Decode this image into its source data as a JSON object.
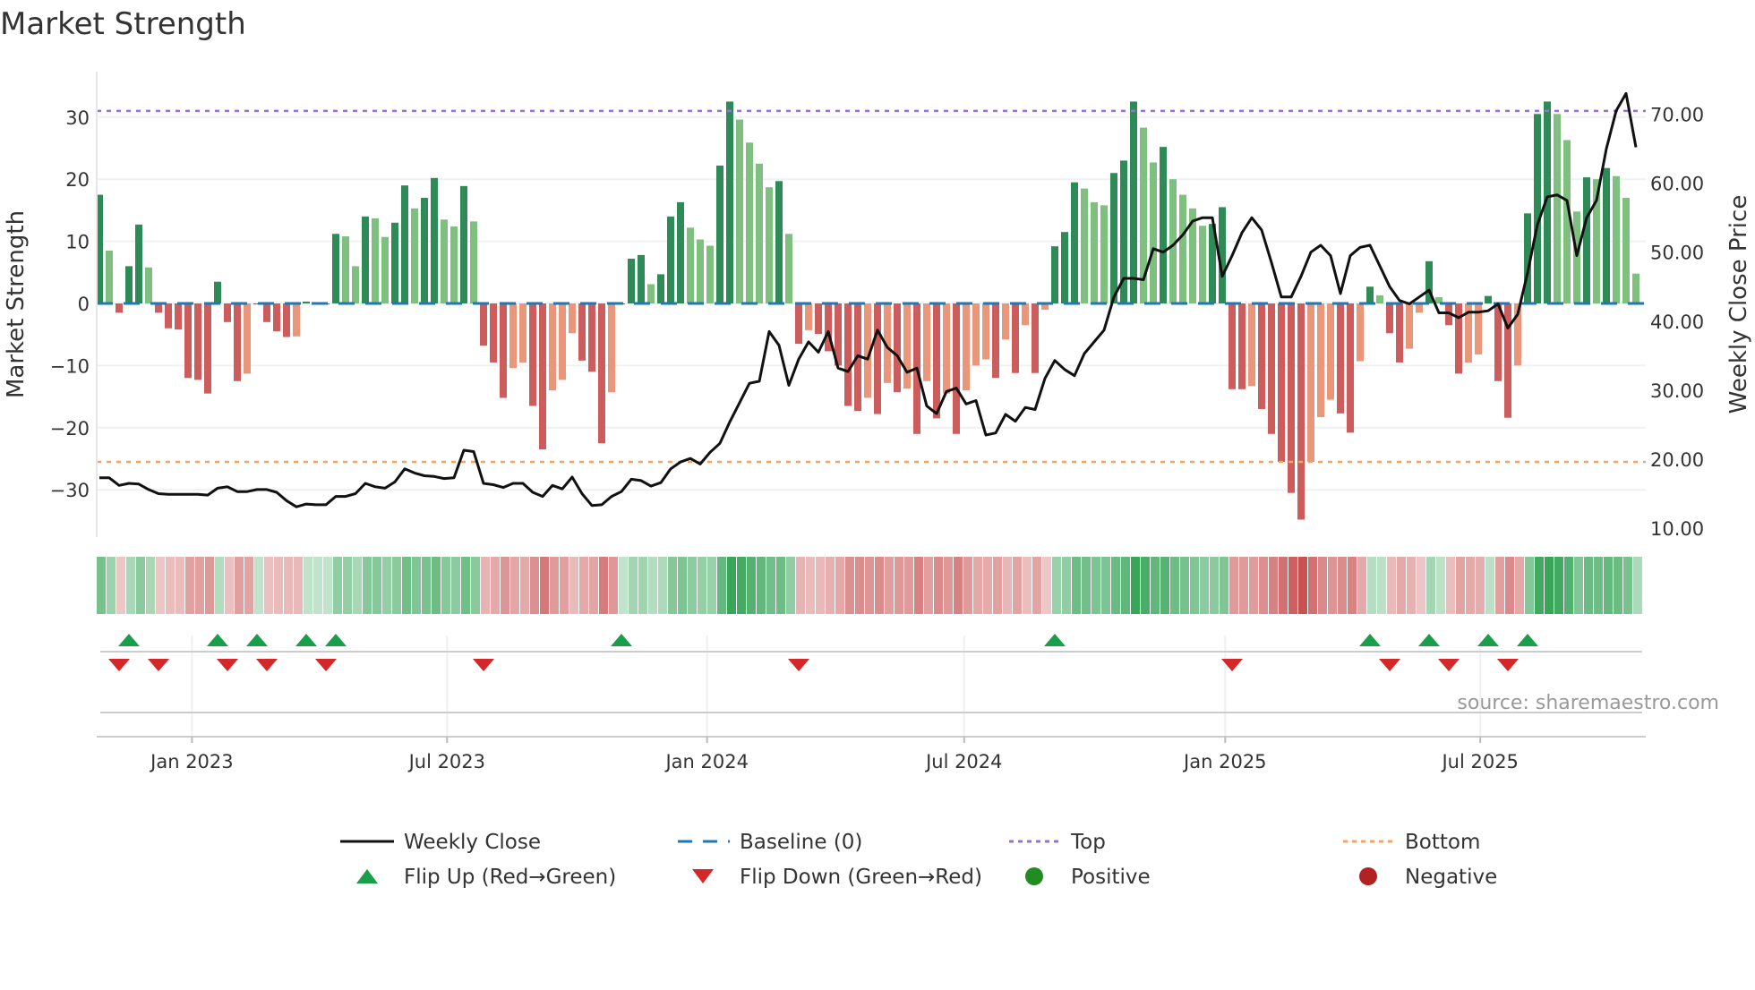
{
  "chart_data": {
    "type": "bar",
    "title": "Market Strength",
    "ylabel": "Market Strength",
    "y2label": "Weekly Close Price",
    "ylim": [
      -37,
      37
    ],
    "y2lim": [
      5,
      77
    ],
    "yticks": [
      30,
      20,
      10,
      0,
      -10,
      -20,
      -30
    ],
    "y2ticks": [
      "70.00",
      "60.00",
      "50.00",
      "40.00",
      "30.00",
      "20.00",
      "10.00"
    ],
    "y2tick_values": [
      70,
      60,
      50,
      40,
      30,
      20,
      10
    ],
    "top_level": 31,
    "bottom_level": -25.5,
    "x_ticks": [
      {
        "label": "Jan 2023",
        "week_index": 9.4
      },
      {
        "label": "Jul 2023",
        "week_index": 35.3
      },
      {
        "label": "Jan 2024",
        "week_index": 61.7
      },
      {
        "label": "Jul 2024",
        "week_index": 87.8
      },
      {
        "label": "Jan 2025",
        "week_index": 114.3
      },
      {
        "label": "Jul 2025",
        "week_index": 140.2
      }
    ],
    "strength": [
      17.5,
      8.5,
      -1.5,
      6,
      12.7,
      5.8,
      -1.5,
      -4,
      -4.2,
      -12,
      -12.3,
      -14.5,
      3.5,
      -3,
      -12.5,
      -11.3,
      0,
      -3,
      -4.5,
      -5.4,
      -5.3,
      0.3,
      0,
      0,
      11.2,
      10.8,
      6,
      14,
      13.7,
      10.7,
      13,
      19,
      15.3,
      17,
      20.2,
      13.5,
      12.4,
      18.9,
      13.2,
      -6.8,
      -9.5,
      -15.2,
      -10.4,
      -9.5,
      -16.5,
      -23.5,
      -14,
      -12.3,
      -4.8,
      -9.2,
      -11,
      -22.5,
      -14.3,
      0,
      7.2,
      7.8,
      3.1,
      4.7,
      14,
      16.3,
      12.2,
      10.3,
      9.3,
      22.2,
      32.5,
      29.6,
      25.9,
      22.5,
      18.7,
      19.7,
      11.2,
      -6.5,
      -4.3,
      -4.9,
      -7.7,
      -10,
      -16.5,
      -17.3,
      -15.2,
      -17.8,
      -12.8,
      -14.3,
      -13.7,
      -21,
      -12.5,
      -18.5,
      -14.5,
      -21,
      -14,
      -10,
      -9,
      -12,
      -5.8,
      -11.2,
      -3.5,
      -11.2,
      -1,
      9.2,
      11.5,
      19.5,
      18.5,
      16.3,
      15.8,
      21,
      23,
      32.5,
      28.3,
      22.7,
      25.2,
      20,
      17.5,
      15.3,
      12.5,
      12.8,
      15.5,
      -13.8,
      -13.8,
      -13.3,
      -17,
      -21,
      -25.5,
      -30.5,
      -34.8,
      -25.5,
      -18.3,
      -15.5,
      -17.7,
      -20.8,
      -9.3,
      2.7,
      1.3,
      -4.8,
      -9.5,
      -7.3,
      -1.5,
      6.8,
      1,
      -3.5,
      -11.3,
      -9.5,
      -8.2,
      1.2,
      -12.5,
      -18.4,
      -10,
      14.5,
      30.5,
      32.5,
      30.5,
      26.3,
      14.8,
      20.3,
      20,
      21.8,
      20.5,
      17,
      4.8
    ],
    "weekly_close": [
      17.3,
      17.3,
      16.2,
      16.5,
      16.4,
      15.6,
      15,
      14.9,
      14.9,
      14.9,
      14.9,
      14.8,
      15.8,
      16,
      15.3,
      15.3,
      15.6,
      15.6,
      15.2,
      14,
      13.1,
      13.5,
      13.4,
      13.4,
      14.6,
      14.6,
      15,
      16.5,
      16,
      15.8,
      16.7,
      18.6,
      18,
      17.6,
      17.5,
      17.2,
      17.3,
      21.3,
      21.1,
      16.5,
      16.3,
      15.9,
      16.5,
      16.5,
      15.2,
      14.6,
      16.2,
      15.7,
      17.4,
      15,
      13.3,
      13.4,
      14.6,
      15.3,
      17.1,
      16.9,
      16.1,
      16.6,
      18.6,
      19.6,
      20.1,
      19.3,
      21,
      22.3,
      25.4,
      28.2,
      31,
      31.3,
      38.5,
      36.5,
      30.7,
      34.5,
      37,
      35.5,
      38.5,
      33.2,
      32.7,
      35,
      34.5,
      38.7,
      36.2,
      35,
      32.6,
      33.2,
      27.7,
      26.6,
      29.8,
      30.3,
      28,
      28.5,
      23.5,
      23.8,
      26.5,
      25.5,
      27.5,
      27.2,
      31.7,
      34.3,
      33,
      32.1,
      35.3,
      37,
      38.7,
      43.5,
      46.2,
      46.2,
      46,
      50.5,
      50,
      51,
      52.5,
      54.5,
      55,
      55,
      46.5,
      49.5,
      52.8,
      55,
      53.2,
      48.5,
      43.5,
      43.5,
      46.5,
      50,
      51,
      49.5,
      44,
      49.5,
      50.7,
      51,
      48,
      45,
      43,
      42.5,
      43.5,
      44.5,
      41.2,
      41.2,
      40.5,
      41.3,
      41.3,
      41.5,
      42.5,
      39,
      41,
      47,
      54,
      58,
      58.3,
      57.5,
      49.5,
      55,
      57.5,
      65,
      70.5,
      73,
      65.2
    ],
    "flip_up_indices": [
      3,
      12,
      16,
      21,
      24,
      53,
      97,
      129,
      135,
      141,
      145
    ],
    "flip_down_indices": [
      2,
      6,
      13,
      17,
      23,
      39,
      71,
      115,
      131,
      137,
      143
    ],
    "legend": [
      {
        "label": "Weekly Close",
        "kind": "line"
      },
      {
        "label": "Baseline (0)",
        "kind": "dash"
      },
      {
        "label": "Top",
        "kind": "dot-purple"
      },
      {
        "label": "Bottom",
        "kind": "dot-orange"
      },
      {
        "label": "Flip Up (Red→Green)",
        "kind": "tri-up"
      },
      {
        "label": "Flip Down (Green→Red)",
        "kind": "tri-down"
      },
      {
        "label": "Positive",
        "kind": "dot-green"
      },
      {
        "label": "Negative",
        "kind": "dot-red"
      }
    ],
    "legend_placement": "bottom",
    "source": "source: sharemaestro.com"
  },
  "colors": {
    "pos_rising": "#2e8b57",
    "pos_falling": "#7fbf7f",
    "neg_falling": "#cd5c5c",
    "neg_rising": "#e9967a",
    "baseline": "#1f77b4",
    "top": "#9370db",
    "bottom": "#f4a460",
    "flip_up": "#1a9e4a",
    "flip_down": "#d62728",
    "positive": "#228b22",
    "negative": "#b22222"
  }
}
